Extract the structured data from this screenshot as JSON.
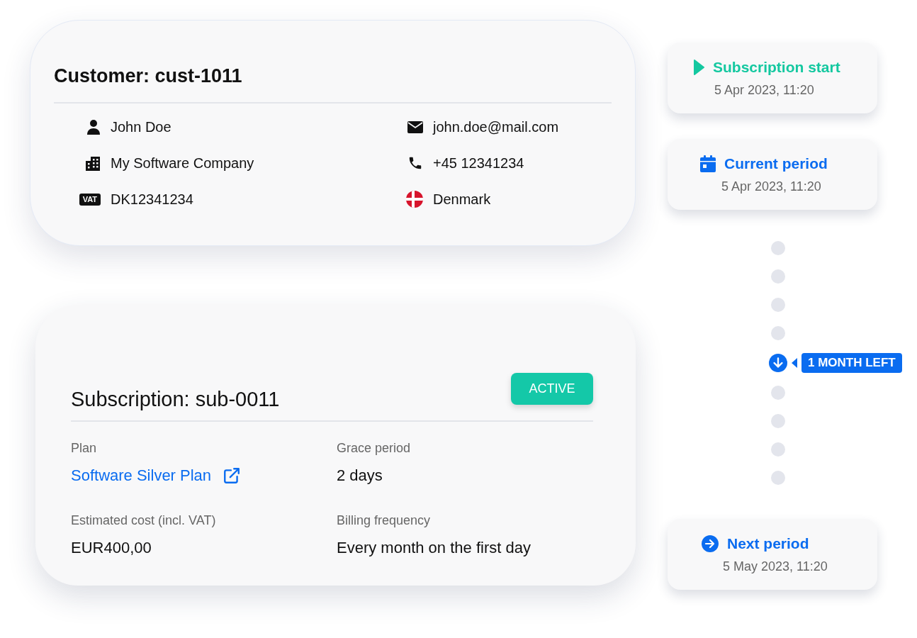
{
  "customer": {
    "title": "Customer: cust-1011",
    "items": [
      {
        "kind": "person",
        "value": "John Doe"
      },
      {
        "kind": "mail",
        "value": "john.doe@mail.com"
      },
      {
        "kind": "building",
        "value": "My Software Company"
      },
      {
        "kind": "phone",
        "value": "+45 12341234"
      },
      {
        "kind": "vat",
        "badge": "VAT",
        "value": "DK12341234"
      },
      {
        "kind": "flag",
        "value": "Denmark"
      }
    ]
  },
  "subscription": {
    "title": "Subscription: sub-0011",
    "status": "ACTIVE",
    "fields": [
      {
        "kind": "link",
        "label": "Plan",
        "value": "Software Silver Plan"
      },
      {
        "kind": "text",
        "label": "Grace period",
        "value": "2 days"
      },
      {
        "kind": "text",
        "label": "Estimated cost (incl. VAT)",
        "value": "EUR400,00"
      },
      {
        "kind": "text",
        "label": "Billing frequency",
        "value": "Every month on the first day"
      }
    ]
  },
  "timeline": {
    "events": [
      {
        "kind": "start",
        "title": "Subscription start",
        "date": "5 Apr 2023, 11:20"
      },
      {
        "kind": "current",
        "title": "Current period",
        "date": "5 Apr 2023, 11:20"
      }
    ],
    "remaining": "1 MONTH LEFT",
    "next": {
      "kind": "next",
      "title": "Next period",
      "date": "5 May 2023, 11:20"
    }
  }
}
